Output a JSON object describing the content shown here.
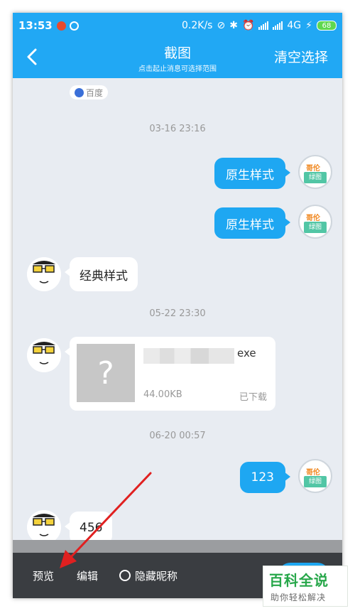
{
  "status_bar": {
    "time": "13:53",
    "net_speed": "0.2K/s",
    "network": "4G",
    "battery": "68"
  },
  "header": {
    "title": "截图",
    "subtitle": "点击起止消息可选择范围",
    "clear_label": "清空选择"
  },
  "chat": {
    "source_badge": "百度",
    "timestamps": [
      "03-16 23:16",
      "05-22 23:30",
      "06-20 00:57"
    ],
    "messages": [
      {
        "side": "right",
        "text": "原生样式"
      },
      {
        "side": "right",
        "text": "原生样式"
      },
      {
        "side": "left",
        "text": "经典样式"
      },
      {
        "side": "left",
        "type": "file",
        "ext": "exe",
        "size": "44.00KB",
        "state": "已下载"
      },
      {
        "side": "right",
        "text": "123"
      },
      {
        "side": "left",
        "text": "456"
      }
    ],
    "avatar_text": {
      "top": "哥伦",
      "bottom": "绿图"
    }
  },
  "bottom_bar": {
    "preview_label": "预览",
    "edit_label": "编辑",
    "hide_nick_label": "隐藏昵称"
  },
  "watermark": {
    "title": "百科全说",
    "subtitle": "助你轻松解决"
  },
  "colors": {
    "accent": "#21a8f4",
    "bubble": "#1ea7f2",
    "chat_bg": "#e8ecf2",
    "bottom_bar": "#3a3d41",
    "arrow": "#e02020"
  }
}
